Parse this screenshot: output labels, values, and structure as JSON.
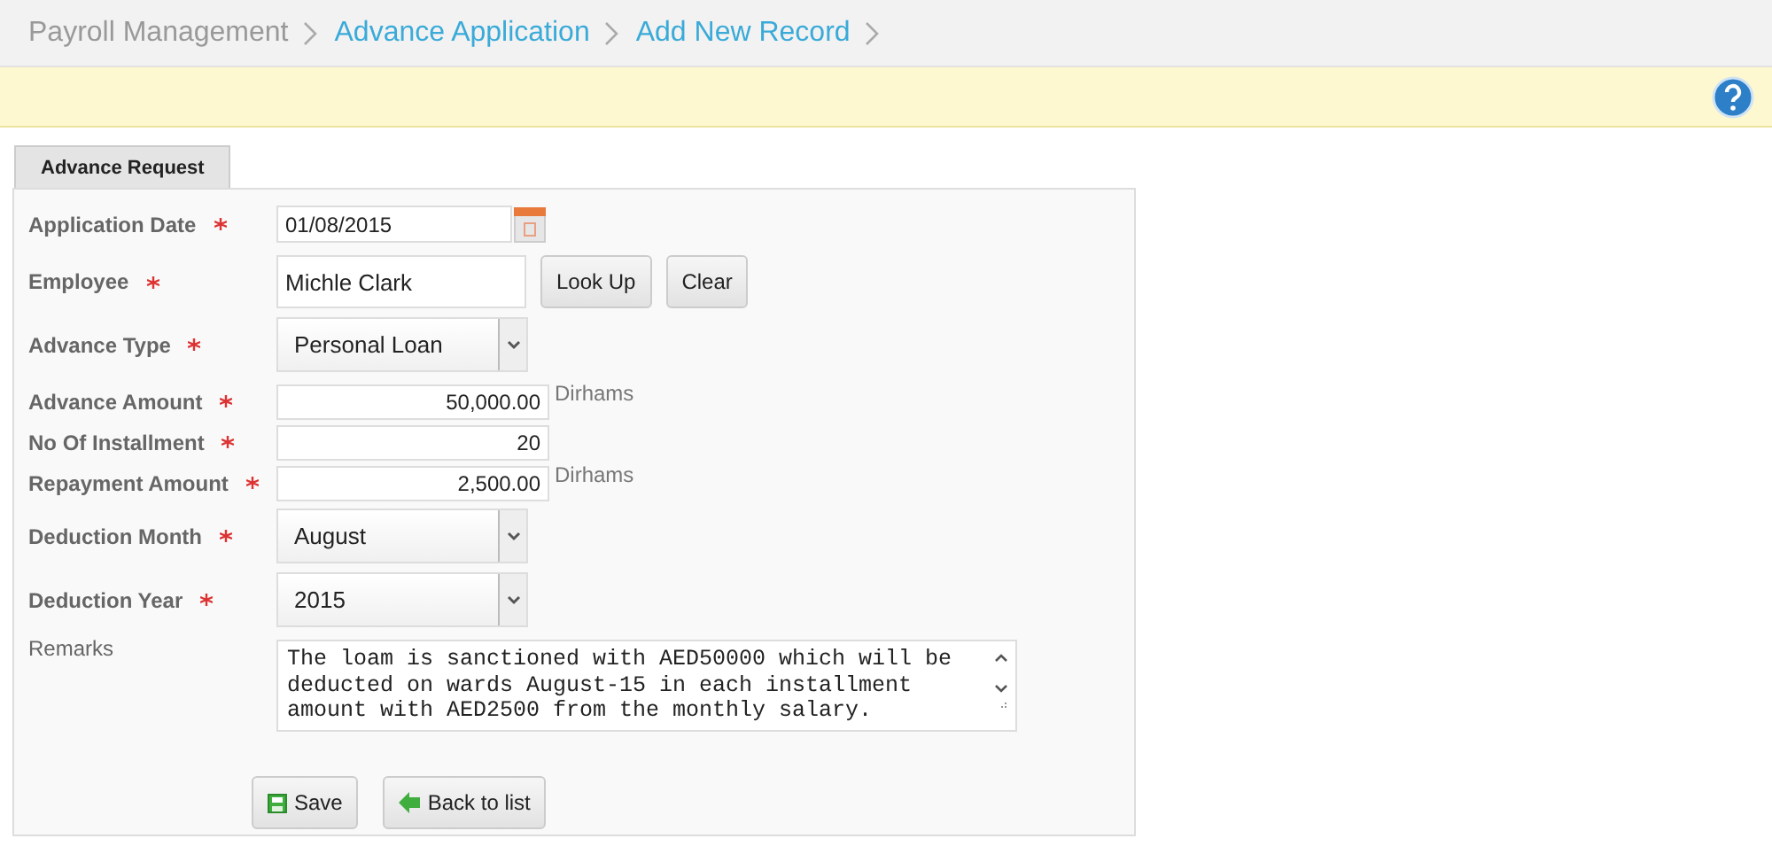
{
  "breadcrumb": [
    {
      "label": "Payroll Management",
      "kind": "plain"
    },
    {
      "label": "Advance Application",
      "kind": "link"
    },
    {
      "label": "Add New Record",
      "kind": "link"
    }
  ],
  "tabs": [
    {
      "label": "Advance Request",
      "selected": true
    }
  ],
  "fields": [
    {
      "kind": "date",
      "label": "Application Date",
      "required": true,
      "value": "01/08/2015"
    },
    {
      "kind": "lookup",
      "label": "Employee",
      "required": true,
      "value": "Michle Clark",
      "buttons": [
        "Look Up",
        "Clear"
      ]
    },
    {
      "kind": "select",
      "label": "Advance Type",
      "required": true,
      "value": "Personal Loan"
    },
    {
      "kind": "number",
      "label": "Advance Amount",
      "required": true,
      "value": "50,000.00",
      "unit": "Dirhams"
    },
    {
      "kind": "number",
      "label": "No Of Installment",
      "required": true,
      "value": "20"
    },
    {
      "kind": "number",
      "label": "Repayment Amount",
      "required": true,
      "value": "2,500.00",
      "unit": "Dirhams"
    },
    {
      "kind": "select",
      "label": "Deduction Month",
      "required": true,
      "value": "August"
    },
    {
      "kind": "select",
      "label": "Deduction Year",
      "required": true,
      "value": "2015"
    },
    {
      "kind": "textarea",
      "label": "Remarks",
      "required": false,
      "value": "The loam is sanctioned with AED50000 which will be deducted on wards August-15 in each installment amount with AED2500 from the monthly salary."
    }
  ],
  "actions": [
    {
      "kind": "save",
      "label": "Save"
    },
    {
      "kind": "back",
      "label": "Back to list"
    }
  ]
}
